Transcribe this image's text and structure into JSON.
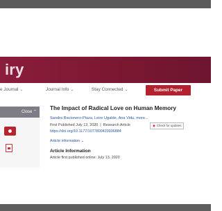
{
  "hero": {
    "title": "iry"
  },
  "nav": {
    "items": [
      {
        "label": "e Journal",
        "chevron": "chevron-down-icon"
      },
      {
        "label": "Journal Info",
        "chevron": "chevron-down-icon"
      },
      {
        "label": "Stay Connected",
        "chevron": "chevron-down-icon"
      }
    ],
    "submit_label": "Submit Paper"
  },
  "sidebar": {
    "close_label": "Close"
  },
  "article": {
    "title": "The Impact of Radical Love on Human Memory",
    "authors": "Sandra Racionero-Plaza, Leire Ugalde, Ana Vidu, more...",
    "published": "First Published July 13, 2020",
    "type": "Research Article",
    "permissions": "Check for updates",
    "doi": "https://doi.org/10.1177/1077800420936884",
    "info_link": "Article information",
    "info_title": "Article Information",
    "info_text": "Article first published online: July 13, 2020"
  },
  "colors": {
    "brand": "#8a1d3b",
    "accent": "#b3212e",
    "link": "#2a57a8"
  }
}
